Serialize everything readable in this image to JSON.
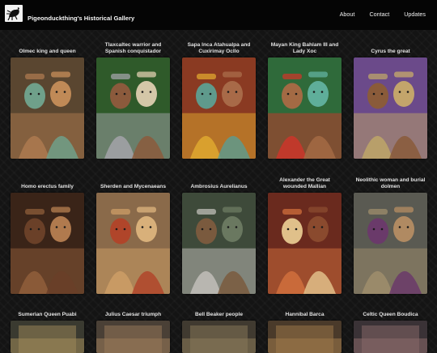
{
  "site": {
    "title": "Pigeonduckthing's Historical Gallery",
    "logo_icon": "pigeon-logo-icon"
  },
  "nav": [
    {
      "label": "About"
    },
    {
      "label": "Contact"
    },
    {
      "label": "Updates"
    }
  ],
  "gallery": [
    {
      "caption": "Olmec king and queen",
      "palette": [
        "#5a4630",
        "#a7764d",
        "#6fa08a",
        "#c08a57"
      ]
    },
    {
      "caption": "Tlaxcaltec warrior and\nSpanish conquistador",
      "palette": [
        "#2f5a2a",
        "#9b9ea0",
        "#8b5a3c",
        "#d4c7a8"
      ]
    },
    {
      "caption": "Sapa Inca Atahualpa and\nCuxirimay Ocllo",
      "palette": [
        "#8a3a22",
        "#d9a02e",
        "#5f9a8c",
        "#a86a48"
      ]
    },
    {
      "caption": "Mayan King Bahlam III and\nLady Xoc",
      "palette": [
        "#2f6a3a",
        "#c0392b",
        "#a36a44",
        "#5fae9a"
      ]
    },
    {
      "caption": "Cyrus the great",
      "palette": [
        "#6b4a8a",
        "#b89f6a",
        "#8a5b3a",
        "#c3a56b"
      ]
    },
    {
      "caption": "Homo erectus family",
      "palette": [
        "#3a2418",
        "#8a5a38",
        "#6a4028",
        "#b07a4e"
      ]
    },
    {
      "caption": "Sherden and Mycenaeans",
      "palette": [
        "#8a6a4a",
        "#c89a64",
        "#b0452a",
        "#d8b07a"
      ]
    },
    {
      "caption": "Ambrosius Aurelianus",
      "palette": [
        "#3e4a3a",
        "#b8b6b0",
        "#7a5a3e",
        "#6a7860"
      ]
    },
    {
      "caption": "Alexander the Great\nwounded Mallian",
      "palette": [
        "#6a2a1e",
        "#c96a3a",
        "#e0c08a",
        "#8a4a2e"
      ]
    },
    {
      "caption": "Neolithic woman and burial\ndolmen",
      "palette": [
        "#5a5a52",
        "#9a8a6a",
        "#6a3a6a",
        "#b08a62"
      ]
    },
    {
      "caption": "Sumerian Queen Puabi",
      "palette": [
        "#3a3a30",
        "#a08a5a"
      ]
    },
    {
      "caption": "Julius Caesar triumph",
      "palette": [
        "#4a4036",
        "#9a7a5a"
      ]
    },
    {
      "caption": "Bell Beaker people",
      "palette": [
        "#403a30",
        "#8a7a5a"
      ]
    },
    {
      "caption": "Hannibal Barca",
      "palette": [
        "#4a3a2a",
        "#a07a4a"
      ]
    },
    {
      "caption": "Celtic Queen Boudica",
      "palette": [
        "#3a3236",
        "#8a6a6a"
      ]
    }
  ]
}
